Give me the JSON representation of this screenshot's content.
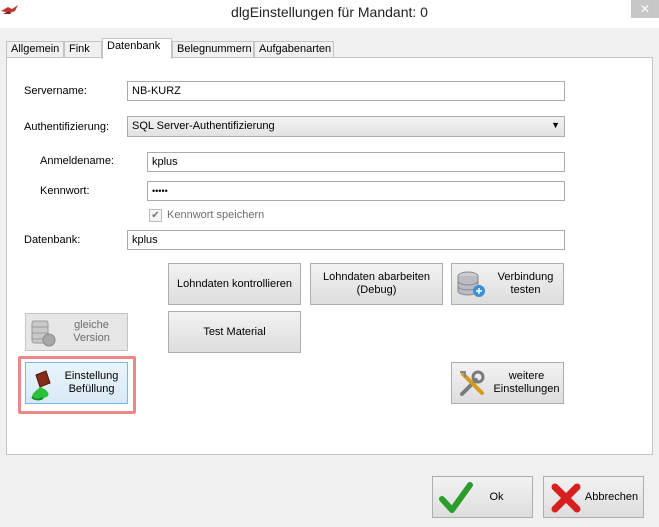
{
  "window": {
    "title": "dlgEinstellungen für Mandant: 0",
    "close": "✕"
  },
  "tabs": [
    {
      "label": "Allgemein"
    },
    {
      "label": "Fink"
    },
    {
      "label": "Datenbank"
    },
    {
      "label": "Belegnummern"
    },
    {
      "label": "Aufgabenarten"
    }
  ],
  "form": {
    "servername_label": "Servername:",
    "servername_value": "NB-KURZ",
    "auth_label": "Authentifizierung:",
    "auth_value": "SQL Server-Authentifizierung",
    "login_label": "Anmeldename:",
    "login_value": "kplus",
    "password_label": "Kennwort:",
    "password_value": "•••••",
    "save_password_label": "Kennwort speichern",
    "save_password_checked": true,
    "database_label": "Datenbank:",
    "database_value": "kplus"
  },
  "buttons": {
    "lohndaten_kontrollieren": "Lohndaten kontrollieren",
    "lohndaten_abarbeiten": "Lohndaten abarbeiten (Debug)",
    "verbindung_testen": "Verbindung testen",
    "gleiche_version": "gleiche Version",
    "test_material": "Test Material",
    "einstellung_befuellung": "Einstellung Befüllung",
    "weitere_einstellungen": "weitere Einstellungen",
    "ok": "Ok",
    "abbrechen": "Abbrechen"
  }
}
